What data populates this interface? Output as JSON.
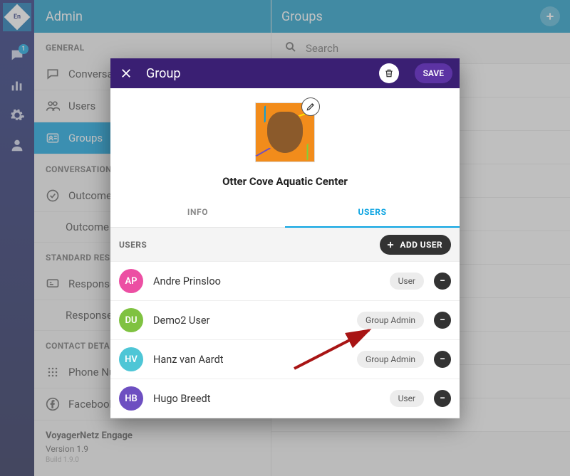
{
  "rail": {
    "logo_text": "En",
    "chat_badge": "1"
  },
  "sidepanel": {
    "title": "Admin",
    "sections": {
      "general": {
        "label": "GENERAL",
        "items": [
          "Conversations",
          "Users",
          "Groups"
        ]
      },
      "conversations": {
        "label": "CONVERSATIONS",
        "items": [
          "Outcomes",
          "Outcome Categories"
        ]
      },
      "standard_responses": {
        "label": "STANDARD RESPONSES",
        "items": [
          "Responses",
          "Response Categories"
        ]
      },
      "contact_details": {
        "label": "CONTACT DETAILS",
        "items": [
          "Phone Numbers",
          "Facebook Pages"
        ]
      }
    },
    "app": {
      "name": "VoyagerNetz Engage",
      "version": "Version 1.9",
      "build": "Build 1.9.0"
    }
  },
  "main": {
    "title": "Groups",
    "search_placeholder": "Search"
  },
  "modal": {
    "title": "Group",
    "save_label": "SAVE",
    "group_name": "Otter Cove Aquatic Center",
    "tabs": {
      "info": "INFO",
      "users": "USERS"
    },
    "users": {
      "label": "USERS",
      "add_label": "ADD USER",
      "list": [
        {
          "initials": "AP",
          "color": "#ec4fa3",
          "name": "Andre Prinsloo",
          "role": "User"
        },
        {
          "initials": "DU",
          "color": "#7fc241",
          "name": "Demo2 User",
          "role": "Group Admin"
        },
        {
          "initials": "HV",
          "color": "#4ec6d6",
          "name": "Hanz van Aardt",
          "role": "Group Admin"
        },
        {
          "initials": "HB",
          "color": "#6d4fc1",
          "name": "Hugo Breedt",
          "role": "User"
        }
      ]
    }
  }
}
